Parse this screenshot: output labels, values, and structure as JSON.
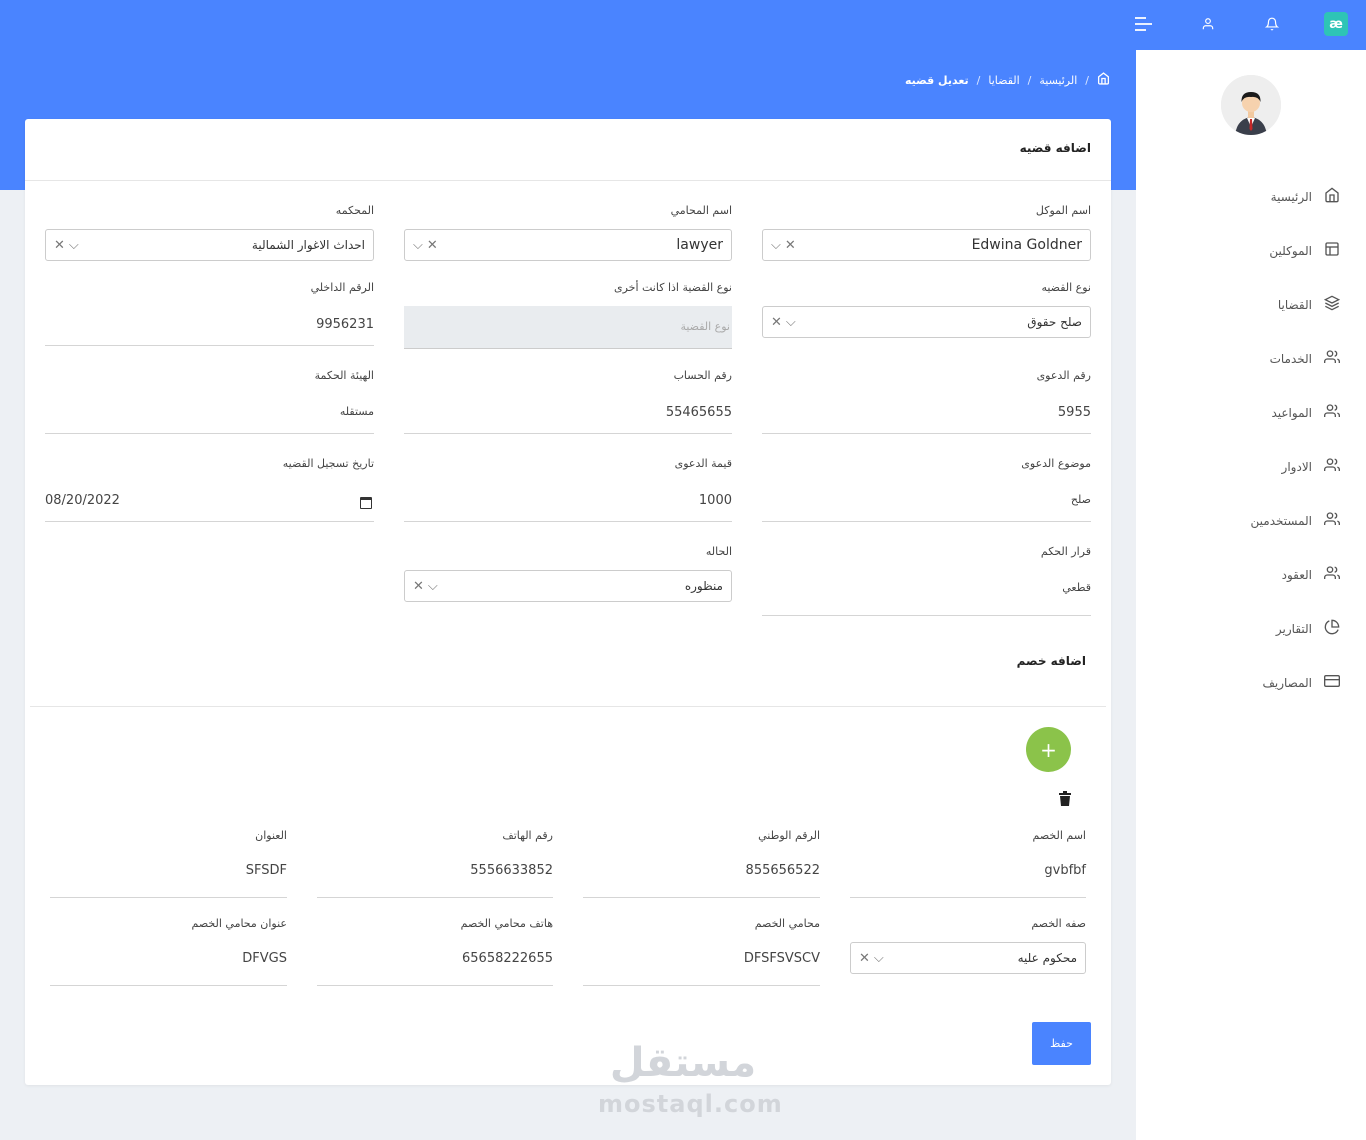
{
  "top_bar": {
    "logo_text": "æ",
    "accent_color": "#4a84ff",
    "logo_color": "#2ec4b6"
  },
  "breadcrumb": {
    "home": "الرئيسية",
    "cases": "القضايا",
    "current": "تعديل قضيه",
    "separator": "/"
  },
  "sidebar": {
    "items": [
      {
        "label": "الرئيسية",
        "icon": "home-icon"
      },
      {
        "label": "الموكلين",
        "icon": "layout-icon"
      },
      {
        "label": "القضايا",
        "icon": "layers-icon"
      },
      {
        "label": "الخدمات",
        "icon": "users-icon"
      },
      {
        "label": "المواعيد",
        "icon": "users-icon"
      },
      {
        "label": "الادوار",
        "icon": "users-icon"
      },
      {
        "label": "المستخدمين",
        "icon": "users-icon"
      },
      {
        "label": "العقود",
        "icon": "users-icon"
      },
      {
        "label": "التقارير",
        "icon": "pie-chart-icon"
      },
      {
        "label": "المصاريف",
        "icon": "credit-card-icon"
      }
    ]
  },
  "form": {
    "title": "اضافه قضيه",
    "client": {
      "label": "اسم الموكل",
      "value": "Edwina Goldner"
    },
    "lawyer": {
      "label": "اسم المحامي",
      "value": "lawyer"
    },
    "court": {
      "label": "المحكمه",
      "value": "احداث الاغوار الشمالية"
    },
    "case_type": {
      "label": "نوع القضيه",
      "value": "صلح حقوق"
    },
    "other_type": {
      "label": "نوع القضية اذا كانت أخرى",
      "placeholder": "نوع القضية"
    },
    "internal_no": {
      "label": "الرقم الداخلي",
      "value": "9956231"
    },
    "lawsuit_no": {
      "label": "رقم الدعوى",
      "value": "5955"
    },
    "account_no": {
      "label": "رقم الحساب",
      "value": "55465655"
    },
    "panel": {
      "label": "الهيئة الحكمة",
      "value": "مستقله"
    },
    "subject": {
      "label": "موضوع الدعوى",
      "value": "صلح"
    },
    "claim_value": {
      "label": "قيمة الدعوى",
      "value": "1000"
    },
    "reg_date": {
      "label": "تاريخ تسجيل القضيه",
      "value": "08/20/2022"
    },
    "verdict": {
      "label": "قرار الحكم",
      "value": "قطعي"
    },
    "status": {
      "label": "الحاله",
      "value": "منظوره"
    }
  },
  "opponent": {
    "title": "اضافه خصم",
    "add_symbol": "+",
    "name": {
      "label": "اسم الخصم",
      "value": "gvbfbf"
    },
    "national_id": {
      "label": "الرقم الوطني",
      "value": "855656522"
    },
    "phone": {
      "label": "رقم الهاتف",
      "value": "5556633852"
    },
    "address": {
      "label": "العنوان",
      "value": "SFSDF"
    },
    "role": {
      "label": "صفه الخصم",
      "value": "محكوم عليه"
    },
    "lawyer": {
      "label": "محامي الخصم",
      "value": "DFSFSVSCV"
    },
    "lawyer_phone": {
      "label": "هاتف محامي الخصم",
      "value": "65658222655"
    },
    "lawyer_address": {
      "label": "عنوان محامي الخصم",
      "value": "DFVGS"
    }
  },
  "save_label": "حفظ",
  "watermark": {
    "arabic": "مستقل",
    "latin": "mostaql.com"
  }
}
